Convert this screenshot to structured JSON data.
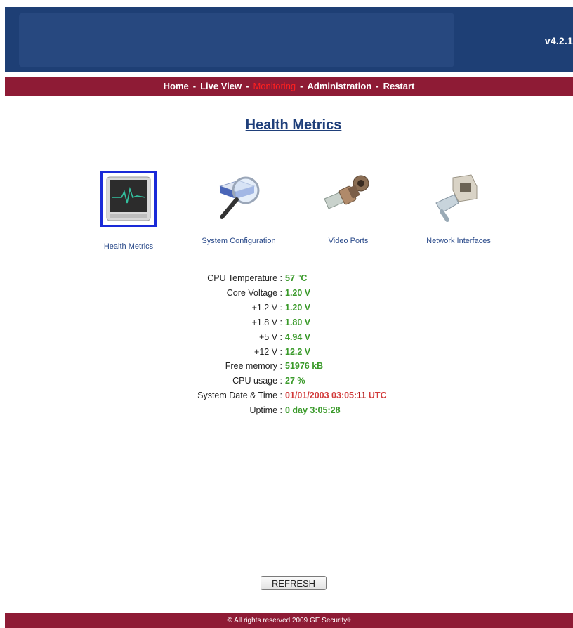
{
  "header": {
    "version": "v4.2.1"
  },
  "nav": {
    "items": [
      {
        "label": "Home"
      },
      {
        "label": "Live View"
      },
      {
        "label": "Monitoring"
      },
      {
        "label": "Administration"
      },
      {
        "label": "Restart"
      }
    ],
    "separator": "-",
    "active": "Monitoring"
  },
  "page": {
    "title": "Health Metrics"
  },
  "tiles": [
    {
      "label": "Health Metrics",
      "icon": "heartbeat-monitor-icon",
      "selected": true
    },
    {
      "label": "System Configuration",
      "icon": "magnifier-device-icon"
    },
    {
      "label": "Video Ports",
      "icon": "bnc-connector-icon"
    },
    {
      "label": "Network Interfaces",
      "icon": "rj45-ethernet-icon"
    }
  ],
  "metrics": [
    {
      "label": "CPU Temperature :",
      "value": "57 °C"
    },
    {
      "label": "Core Voltage :",
      "value": "1.20 V"
    },
    {
      "label": "+1.2 V :",
      "value": "1.20 V"
    },
    {
      "label": "+1.8 V :",
      "value": "1.80 V"
    },
    {
      "label": "+5 V :",
      "value": "4.94 V"
    },
    {
      "label": "+12 V :",
      "value": "12.2 V"
    },
    {
      "label": "Free memory :",
      "value": "51976 kB"
    },
    {
      "label": "CPU usage :",
      "value": "27 %"
    },
    {
      "label": "System Date & Time :",
      "value_date": "01/01/2003 03:05:",
      "value_seconds": "11",
      "value_tz": " UTC"
    },
    {
      "label": "Uptime :",
      "value": "0 day 3:05:28"
    }
  ],
  "refresh_label": "REFRESH",
  "footer": {
    "text": "© All rights reserved 2009  GE Security",
    "mark": "®"
  },
  "colors": {
    "header": "#1e3f75",
    "nav": "#8e1b35",
    "value_green": "#3a9a2a",
    "value_red": "#d23a3a"
  }
}
